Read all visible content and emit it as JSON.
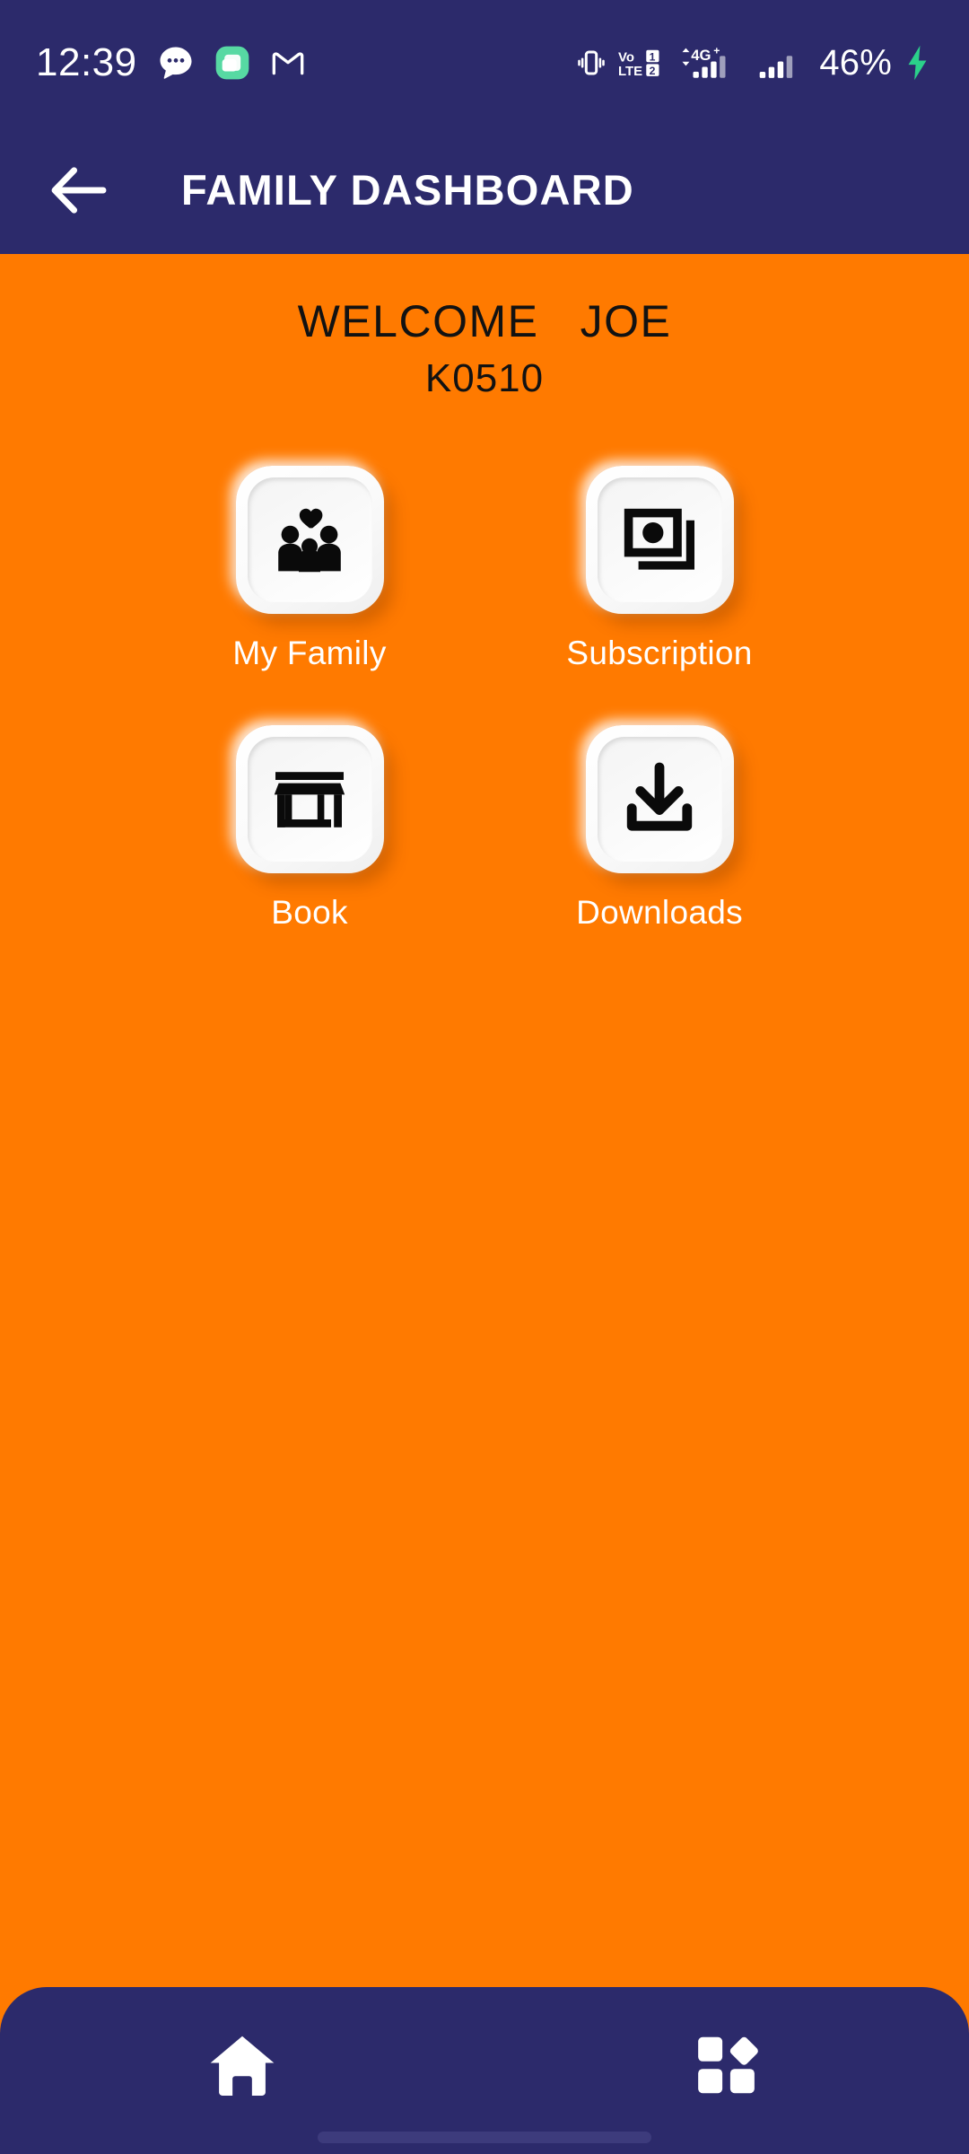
{
  "status_bar": {
    "time": "12:39",
    "battery_percent": "46%",
    "network_label": "4G+",
    "volte_label": "VoLTE",
    "sim_badges": [
      "1",
      "2"
    ],
    "charging": true,
    "left_icons": [
      "messages-bubble-icon",
      "green-app-icon",
      "gmail-icon"
    ],
    "right_icons": [
      "vibrate-icon",
      "volte-icon",
      "signal-bars-sim1-icon",
      "signal-bars-sim2-icon",
      "charging-bolt-icon"
    ]
  },
  "app_bar": {
    "back_icon": "back-arrow-icon",
    "title": "FAMILY DASHBOARD"
  },
  "welcome": {
    "greeting": "WELCOME   JOE",
    "member_id": "K0510"
  },
  "grid": {
    "items": [
      {
        "label": "My Family",
        "icon": "family-icon"
      },
      {
        "label": "Subscription",
        "icon": "subscription-cards-icon"
      },
      {
        "label": "Book",
        "icon": "store-front-icon"
      },
      {
        "label": "Downloads",
        "icon": "download-icon"
      }
    ]
  },
  "bottom_nav": {
    "items": [
      {
        "name": "home",
        "icon": "home-icon"
      },
      {
        "name": "dashboard",
        "icon": "dashboard-grid-icon"
      }
    ]
  },
  "colors": {
    "navy": "#2C2A6B",
    "orange": "#FF7A00",
    "tile_white": "#FFFFFF",
    "text_black": "#121212",
    "charging_green": "#2BD08A"
  }
}
